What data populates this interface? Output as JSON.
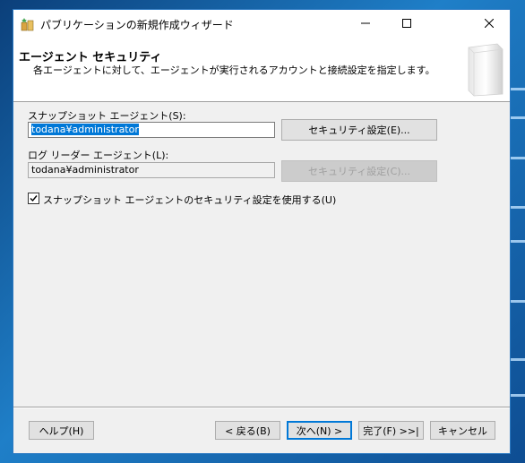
{
  "window": {
    "title": "パブリケーションの新規作成ウィザード"
  },
  "header": {
    "title": "エージェント セキュリティ",
    "description": "各エージェントに対して、エージェントが実行されるアカウントと接続設定を指定します。"
  },
  "snapshot_agent": {
    "label": "スナップショット エージェント(S):",
    "value": "todana¥administrator",
    "button_label": "セキュリティ設定(E)..."
  },
  "log_reader_agent": {
    "label": "ログ リーダー エージェント(L):",
    "value": "todana¥administrator",
    "button_label": "セキュリティ設定(C)..."
  },
  "use_snapshot_security": {
    "label": "スナップショット エージェントのセキュリティ設定を使用する(U)",
    "checked": true
  },
  "footer": {
    "help_label": "ヘルプ(H)",
    "back_label": "< 戻る(B)",
    "next_label": "次へ(N) >",
    "finish_label": "完了(F) >>|",
    "cancel_label": "キャンセル"
  },
  "colors": {
    "accent": "#0078d7",
    "window_border": "#2b79c2",
    "dialog_bg": "#f0f0f0"
  }
}
